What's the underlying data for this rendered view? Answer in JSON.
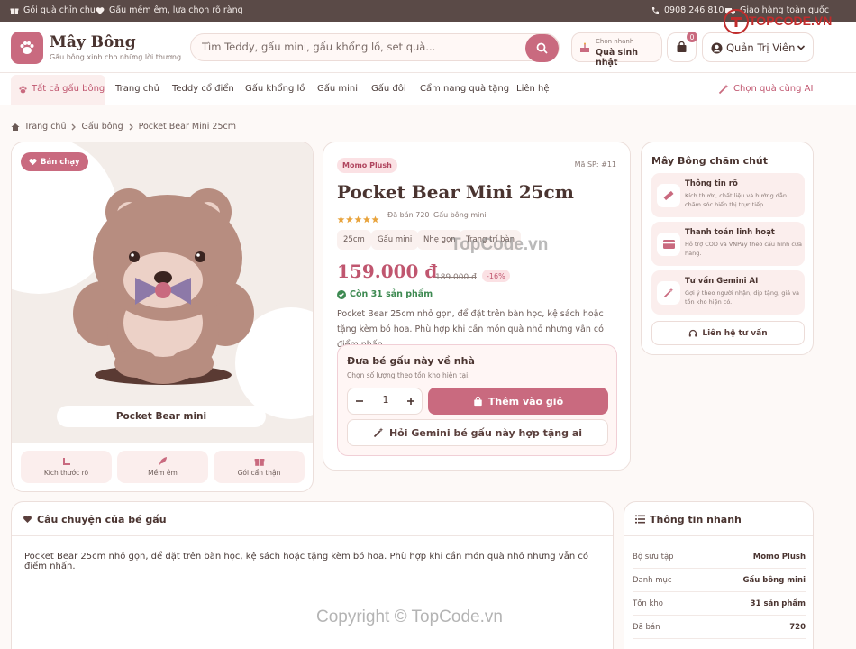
{
  "topbar": {
    "left1": "Gói quà chỉn chu",
    "left2": "Gấu mềm êm, lựa chọn rõ ràng",
    "phone": "0908 246 810",
    "shipping": "Giao hàng toàn quốc"
  },
  "header": {
    "brand": "Mây Bông",
    "tagline": "Gấu bông xinh cho những lời thương",
    "search_placeholder": "Tìm Teddy, gấu mini, gấu khổng lồ, set quà...",
    "quick_label": "Chọn nhanh",
    "quick_value": "Quà sinh nhật",
    "cart_count": "0",
    "user_name": "Quản Trị Viên"
  },
  "nav": {
    "items": [
      "Tất cả gấu bông",
      "Trang chủ",
      "Teddy cổ điển",
      "Gấu khổng lồ",
      "Gấu mini",
      "Gấu đôi",
      "Cẩm nang quà tặng",
      "Liên hệ"
    ],
    "ai_pick": "Chọn quà cùng AI"
  },
  "breadcrumb": [
    "Trang chủ",
    "Gấu bông",
    "Pocket Bear Mini 25cm"
  ],
  "gallery": {
    "badge": "Bán chạy",
    "caption": "Pocket Bear mini",
    "features": [
      "Kích thước rõ",
      "Mềm êm",
      "Gói cẩn thận"
    ]
  },
  "product": {
    "collection": "Momo Plush",
    "sku": "Mã SP: #11",
    "name": "Pocket Bear Mini 25cm",
    "rating": 5,
    "sold": "Đã bán 720",
    "category": "Gấu bông mini",
    "tags": [
      "25cm",
      "Gấu mini",
      "Nhẹ gọn",
      "Trang trí bàn"
    ],
    "price": "159.000 đ",
    "old_price": "189.000 đ",
    "discount": "-16%",
    "stock": "Còn 31 sản phẩm",
    "description": "Pocket Bear 25cm nhỏ gọn, để đặt trên bàn học, kệ sách hoặc tặng kèm bó hoa. Phù hợp khi cần món quà nhỏ nhưng vẫn có điểm nhấn..."
  },
  "buy": {
    "title": "Đưa bé gấu này về nhà",
    "subtitle": "Chọn số lượng theo tồn kho hiện tại.",
    "quantity": "1",
    "add_to_cart": "Thêm vào giỏ",
    "ask_ai": "Hỏi Gemini bé gấu này hợp tặng ai"
  },
  "care": {
    "title": "Mây Bông chăm chút",
    "items": [
      {
        "title": "Thông tin rõ",
        "desc": "Kích thước, chất liệu và hướng dẫn chăm sóc hiển thị trực tiếp."
      },
      {
        "title": "Thanh toán linh hoạt",
        "desc": "Hỗ trợ COD và VNPay theo cấu hình cửa hàng."
      },
      {
        "title": "Tư vấn Gemini AI",
        "desc": "Gợi ý theo người nhận, dịp tặng, giá và tồn kho hiện có."
      }
    ],
    "consult": "Liên hệ tư vấn"
  },
  "story": {
    "title": "Câu chuyện của bé gấu",
    "body": "Pocket Bear 25cm nhỏ gọn, để đặt trên bàn học, kệ sách hoặc tặng kèm bó hoa. Phù hợp khi cần món quà nhỏ nhưng vẫn có điểm nhấn."
  },
  "quick_info": {
    "title": "Thông tin nhanh",
    "rows": [
      {
        "k": "Bộ sưu tập",
        "v": "Momo Plush"
      },
      {
        "k": "Danh mục",
        "v": "Gấu bông mini"
      },
      {
        "k": "Tồn kho",
        "v": "31 sản phẩm"
      },
      {
        "k": "Đã bán",
        "v": "720"
      }
    ]
  },
  "watermarks": {
    "top": "TOPCODE.VN",
    "center": "TopCode.vn",
    "bottom": "Copyright © TopCode.vn"
  },
  "colors": {
    "accent": "#c96a7f",
    "topbar": "#5a4a47",
    "price": "#c0566f",
    "stock": "#3e8a52",
    "star": "#e8a33c"
  }
}
